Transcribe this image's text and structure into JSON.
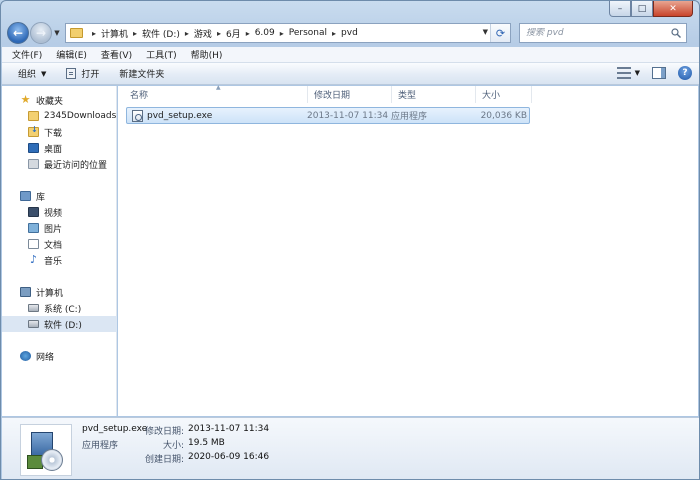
{
  "window": {
    "buttons": {
      "minimize": "–",
      "maximize": "□",
      "close": "✕"
    }
  },
  "nav": {
    "back_glyph": "←",
    "forward_glyph": "→",
    "breadcrumb": [
      "计算机",
      "软件 (D:)",
      "游戏",
      "6月",
      "6.09",
      "Personal",
      "pvd"
    ],
    "search_placeholder": "搜索 pvd"
  },
  "menubar": [
    "文件(F)",
    "编辑(E)",
    "查看(V)",
    "工具(T)",
    "帮助(H)"
  ],
  "toolbar": {
    "organize": "组织",
    "open": "打开",
    "new_folder": "新建文件夹",
    "help": "?"
  },
  "sidebar": {
    "favorites_label": "收藏夹",
    "favorites": [
      "2345Downloads",
      "下载",
      "桌面",
      "最近访问的位置"
    ],
    "libraries_label": "库",
    "libraries": [
      "视频",
      "图片",
      "文档",
      "音乐"
    ],
    "computer_label": "计算机",
    "drives": [
      "系统 (C:)",
      "软件 (D:)"
    ],
    "network_label": "网络"
  },
  "columns": [
    "名称",
    "修改日期",
    "类型",
    "大小"
  ],
  "files": [
    {
      "name": "pvd_setup.exe",
      "modified": "2013-11-07 11:34",
      "type": "应用程序",
      "size": "20,036 KB"
    }
  ],
  "details": {
    "name": "pvd_setup.exe",
    "type": "应用程序",
    "modified_label": "修改日期:",
    "modified": "2013-11-07 11:34",
    "size_label": "大小:",
    "size": "19.5 MB",
    "created_label": "创建日期:",
    "created": "2020-06-09 16:46"
  }
}
